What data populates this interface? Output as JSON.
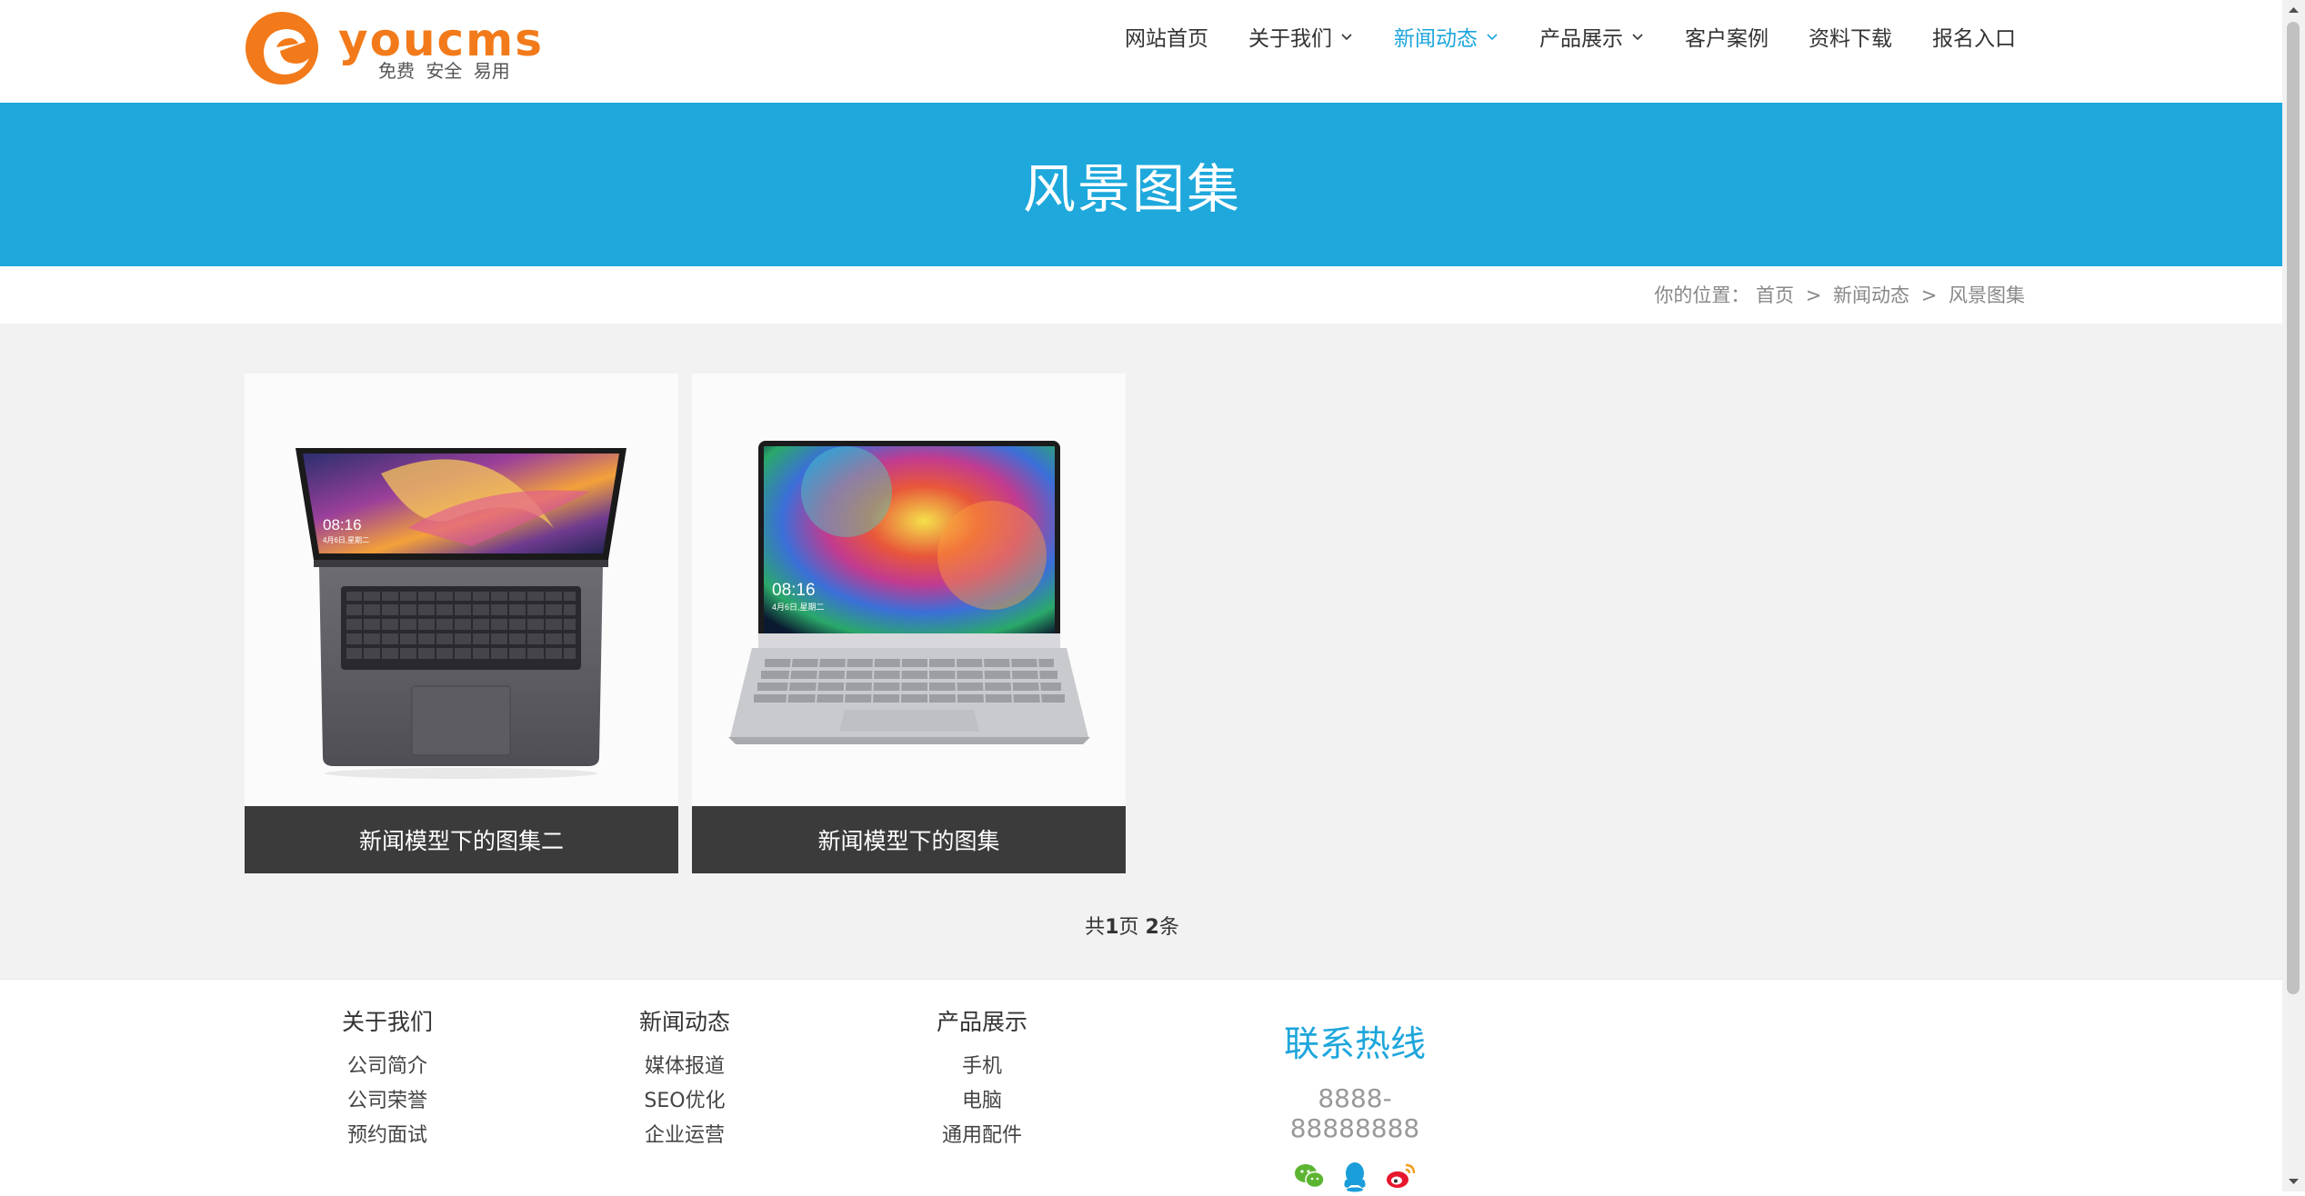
{
  "header": {
    "logo": {
      "word": "youcms",
      "tagline": "免费 安全 易用"
    },
    "nav": [
      {
        "label": "网站首页",
        "dropdown": false,
        "active": false
      },
      {
        "label": "关于我们",
        "dropdown": true,
        "active": false
      },
      {
        "label": "新闻动态",
        "dropdown": true,
        "active": true
      },
      {
        "label": "产品展示",
        "dropdown": true,
        "active": false
      },
      {
        "label": "客户案例",
        "dropdown": false,
        "active": false
      },
      {
        "label": "资料下载",
        "dropdown": false,
        "active": false
      },
      {
        "label": "报名入口",
        "dropdown": false,
        "active": false
      }
    ]
  },
  "banner": {
    "title": "风景图集"
  },
  "breadcrumb": {
    "prefix": "你的位置：",
    "items": [
      "首页",
      "新闻动态",
      "风景图集"
    ],
    "separator": ">"
  },
  "cards": [
    {
      "caption": "新闻模型下的图集二",
      "screen_time": "08:16",
      "screen_date": "4月6日,星期二"
    },
    {
      "caption": "新闻模型下的图集",
      "screen_time": "08:16",
      "screen_date": "4月6日,星期二"
    }
  ],
  "pager": {
    "p1": "共",
    "pages": "1",
    "p2": "页 ",
    "count": "2",
    "p3": "条"
  },
  "footer": {
    "columns": [
      {
        "title": "关于我们",
        "links": [
          "公司简介",
          "公司荣誉",
          "预约面试"
        ]
      },
      {
        "title": "新闻动态",
        "links": [
          "媒体报道",
          "SEO优化",
          "企业运营"
        ]
      },
      {
        "title": "产品展示",
        "links": [
          "手机",
          "电脑",
          "通用配件"
        ]
      }
    ],
    "hotline": {
      "title": "联系热线",
      "phone": "8888-88888888"
    },
    "social": [
      "wechat-icon",
      "qq-icon",
      "weibo-icon"
    ]
  },
  "colors": {
    "accent": "#1ea8dc",
    "logo": "#f27a1a",
    "caption_bg": "#3b3b3b"
  }
}
